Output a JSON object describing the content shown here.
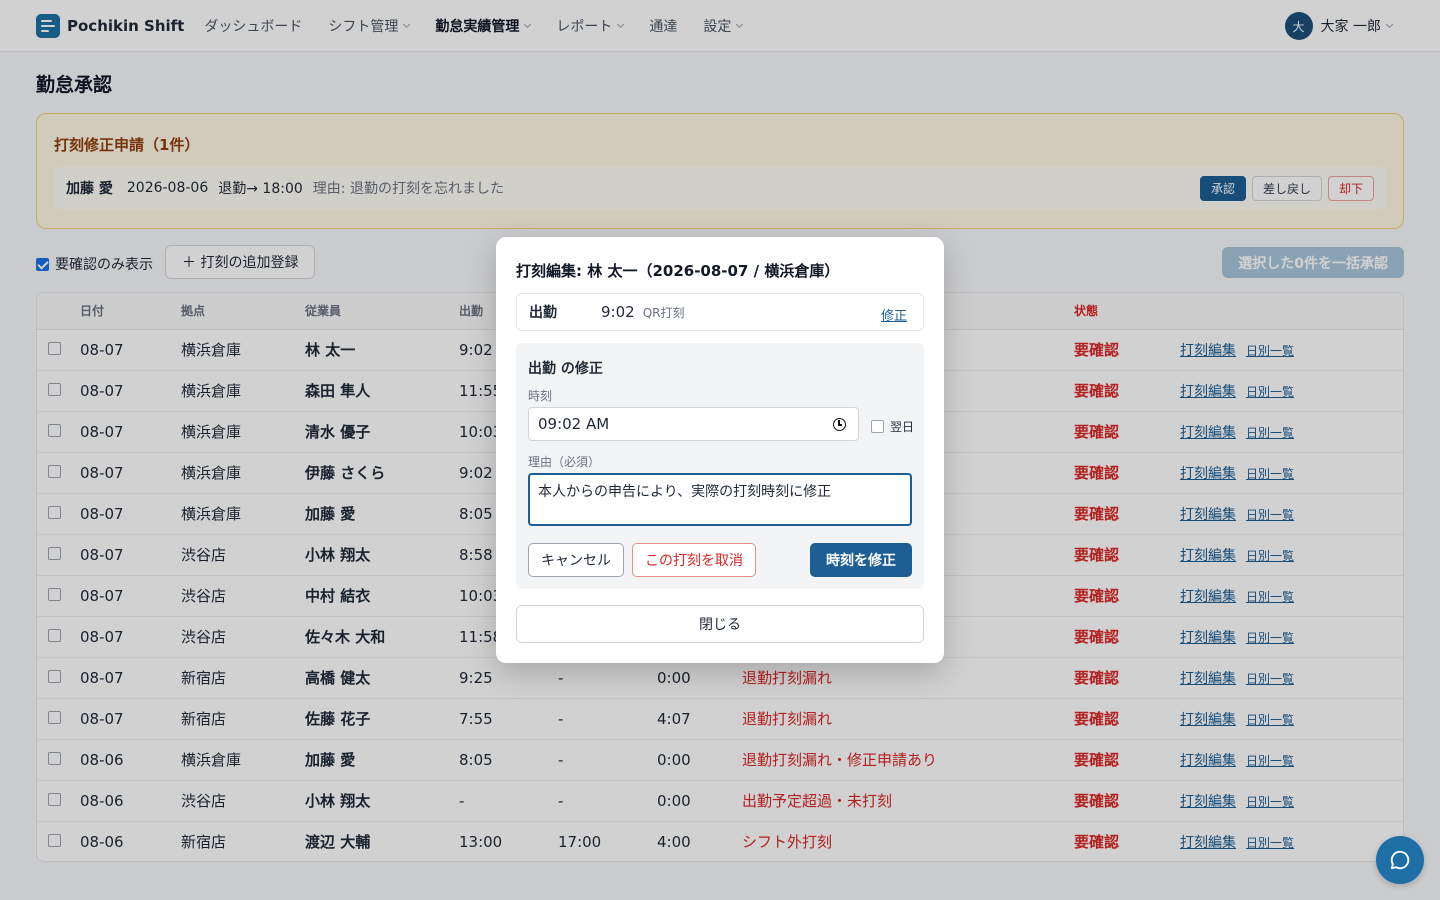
{
  "app": {
    "name": "Pochikin Shift"
  },
  "nav": [
    {
      "label": "ダッシュボード",
      "dropdown": false,
      "active": false
    },
    {
      "label": "シフト管理",
      "dropdown": true,
      "active": false
    },
    {
      "label": "勤怠実績管理",
      "dropdown": true,
      "active": true
    },
    {
      "label": "レポート",
      "dropdown": true,
      "active": false
    },
    {
      "label": "通達",
      "dropdown": false,
      "active": false
    },
    {
      "label": "設定",
      "dropdown": true,
      "active": false
    }
  ],
  "user": {
    "initial": "大",
    "name": "大家 一郎"
  },
  "page": {
    "title": "勤怠承認"
  },
  "correction": {
    "title": "打刻修正申請（1件）",
    "request": {
      "name": "加藤 愛",
      "date": "2026-08-06",
      "type": "退勤→ 18:00",
      "reason": "理由: 退勤の打刻を忘れました",
      "approve": "承認",
      "return": "差し戻し",
      "reject": "却下"
    }
  },
  "toolbar": {
    "filter_label": "要確認のみ表示",
    "filter_checked": true,
    "add_button": "＋ 打刻の追加登録",
    "bulk_button": "選択した0件を一括承認"
  },
  "table": {
    "headers": {
      "date": "日付",
      "site": "拠点",
      "employee": "従業員",
      "clock_in": "出勤",
      "status": "状態"
    },
    "edit_link": "打刻編集",
    "daily_link": "日別一覧",
    "rows": [
      {
        "date": "08-07",
        "site": "横浜倉庫",
        "employee": "林 太一",
        "in": "9:02",
        "out": "",
        "work": "",
        "note": "",
        "status": "要確認"
      },
      {
        "date": "08-07",
        "site": "横浜倉庫",
        "employee": "森田 隼人",
        "in": "11:55",
        "out": "",
        "work": "",
        "note": "",
        "status": "要確認"
      },
      {
        "date": "08-07",
        "site": "横浜倉庫",
        "employee": "清水 優子",
        "in": "10:03",
        "out": "",
        "work": "",
        "note": "",
        "status": "要確認"
      },
      {
        "date": "08-07",
        "site": "横浜倉庫",
        "employee": "伊藤 さくら",
        "in": "9:02",
        "out": "",
        "work": "",
        "note": "",
        "status": "要確認"
      },
      {
        "date": "08-07",
        "site": "横浜倉庫",
        "employee": "加藤 愛",
        "in": "8:05",
        "out": "",
        "work": "",
        "note": "",
        "status": "要確認"
      },
      {
        "date": "08-07",
        "site": "渋谷店",
        "employee": "小林 翔太",
        "in": "8:58",
        "out": "",
        "work": "",
        "note": "",
        "status": "要確認"
      },
      {
        "date": "08-07",
        "site": "渋谷店",
        "employee": "中村 結衣",
        "in": "10:03",
        "out": "",
        "work": "",
        "note": "",
        "status": "要確認"
      },
      {
        "date": "08-07",
        "site": "渋谷店",
        "employee": "佐々木 大和",
        "in": "11:58",
        "out": "",
        "work": "",
        "note": "",
        "status": "要確認"
      },
      {
        "date": "08-07",
        "site": "新宿店",
        "employee": "高橋 健太",
        "in": "9:25",
        "out": "-",
        "work": "0:00",
        "note": "退勤打刻漏れ",
        "status": "要確認"
      },
      {
        "date": "08-07",
        "site": "新宿店",
        "employee": "佐藤 花子",
        "in": "7:55",
        "out": "-",
        "work": "4:07",
        "note": "退勤打刻漏れ",
        "status": "要確認"
      },
      {
        "date": "08-06",
        "site": "横浜倉庫",
        "employee": "加藤 愛",
        "in": "8:05",
        "out": "-",
        "work": "0:00",
        "note": "退勤打刻漏れ・修正申請あり",
        "status": "要確認"
      },
      {
        "date": "08-06",
        "site": "渋谷店",
        "employee": "小林 翔太",
        "in": "-",
        "out": "-",
        "work": "0:00",
        "note": "出勤予定超過・未打刻",
        "status": "要確認"
      },
      {
        "date": "08-06",
        "site": "新宿店",
        "employee": "渡辺 大輔",
        "in": "13:00",
        "out": "17:00",
        "work": "4:00",
        "note": "シフト外打刻",
        "status": "要確認"
      }
    ]
  },
  "modal": {
    "title": "打刻編集: 林 太一（2026-08-07 / 横浜倉庫）",
    "punch": {
      "type": "出勤",
      "time": "9:02",
      "method": "QR打刻",
      "edit": "修正"
    },
    "edit_title": "出勤 の修正",
    "time_label": "時刻",
    "time_value": "09:02 AM",
    "next_day": "翌日",
    "next_day_checked": false,
    "reason_label": "理由（必須）",
    "reason_value": "本人からの申告により、実際の打刻時刻に修正",
    "cancel": "キャンセル",
    "void": "この打刻を取消",
    "submit": "時刻を修正",
    "close": "閉じる"
  }
}
